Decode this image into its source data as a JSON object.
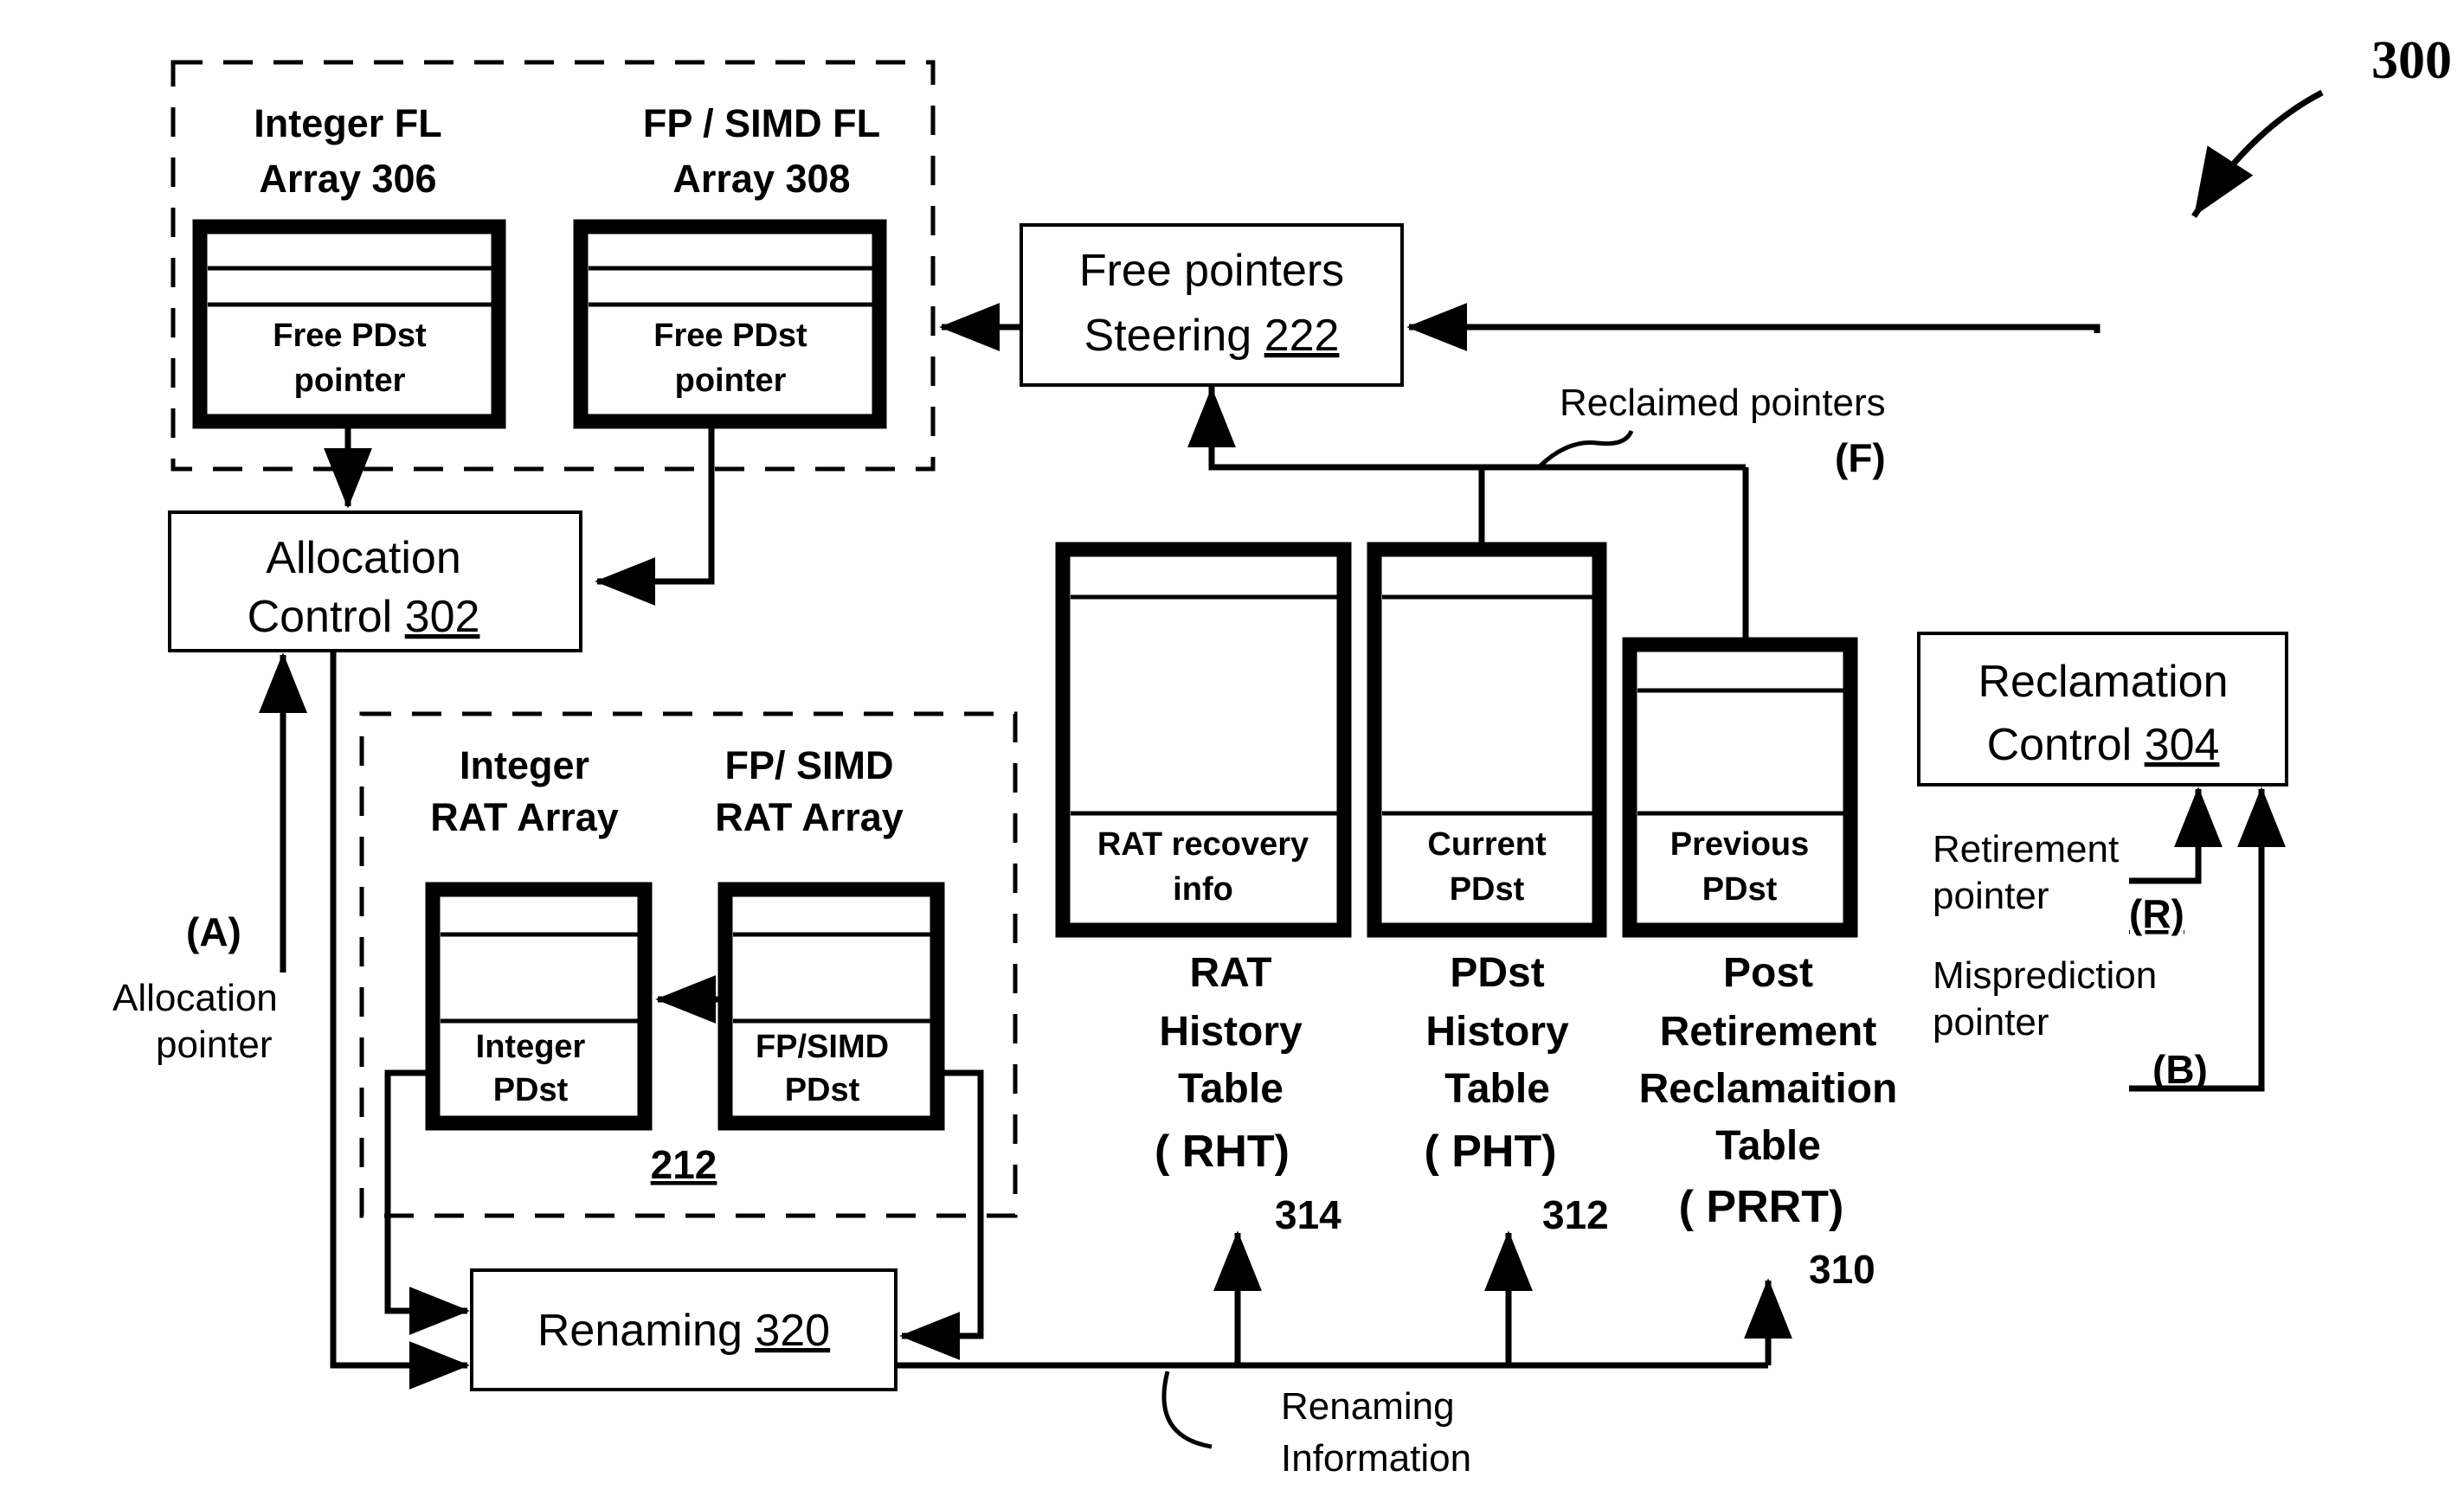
{
  "figure": {
    "ref_number": "300",
    "type": "patent-block-diagram"
  },
  "dashed_groups": {
    "free_list": {
      "arrays": [
        {
          "title_line1": "Integer FL",
          "title_line2": "Array 306",
          "cell_label_line1": "Free PDst",
          "cell_label_line2": "pointer"
        },
        {
          "title_line1": "FP / SIMD FL",
          "title_line2": "Array 308",
          "cell_label_line1": "Free PDst",
          "cell_label_line2": "pointer"
        }
      ]
    },
    "rat": {
      "ref": "212",
      "arrays": [
        {
          "title_line1": "Integer",
          "title_line2": "RAT Array",
          "cell_label_line1": "Integer",
          "cell_label_line2": "PDst"
        },
        {
          "title_line1": "FP/ SIMD",
          "title_line2": "RAT Array",
          "cell_label_line1": "FP/SIMD",
          "cell_label_line2": "PDst"
        }
      ]
    }
  },
  "blocks": {
    "allocation_control": {
      "line1": "Allocation",
      "line2_text": "Control ",
      "line2_ref": "302"
    },
    "free_pointers_steering": {
      "line1": "Free pointers",
      "line2_text": "Steering ",
      "line2_ref": "222"
    },
    "reclamation_control": {
      "line1": "Reclamation",
      "line2_text": "Control ",
      "line2_ref": "304"
    },
    "renaming": {
      "text": "Renaming ",
      "ref": "320"
    }
  },
  "tables": [
    {
      "id": "rht",
      "cell_label_line1": "RAT recovery",
      "cell_label_line2": "info",
      "caption_lines": [
        "RAT",
        "History",
        "Table",
        "( RHT)"
      ],
      "ref": "314"
    },
    {
      "id": "pht",
      "cell_label_line1": "Current",
      "cell_label_line2": "PDst",
      "caption_lines": [
        "PDst",
        "History",
        "Table",
        "( PHT)"
      ],
      "ref": "312"
    },
    {
      "id": "prrt",
      "cell_label_line1": "Previous",
      "cell_label_line2": "PDst",
      "caption_lines": [
        "Post",
        "Retirement",
        "Reclamaition",
        "Table",
        "( PRRT)"
      ],
      "ref": "310"
    }
  ],
  "annotations": {
    "reclaimed_pointers": {
      "label_line1": "Reclaimed pointers",
      "tag": "(F)"
    },
    "allocation_pointer": {
      "tag": "(A)",
      "label_line1": "Allocation",
      "label_line2": "pointer"
    },
    "retirement_pointer": {
      "label_line1": "Retirement",
      "label_line2": "pointer",
      "tag": "(R)"
    },
    "misprediction_pointer": {
      "label_line1": "Misprediction",
      "label_line2": "pointer",
      "tag": "(B)"
    },
    "renaming_information": {
      "label_line1": "Renaming",
      "label_line2": "Information"
    }
  },
  "colors": {
    "ink": "#000000",
    "paper": "#ffffff"
  }
}
